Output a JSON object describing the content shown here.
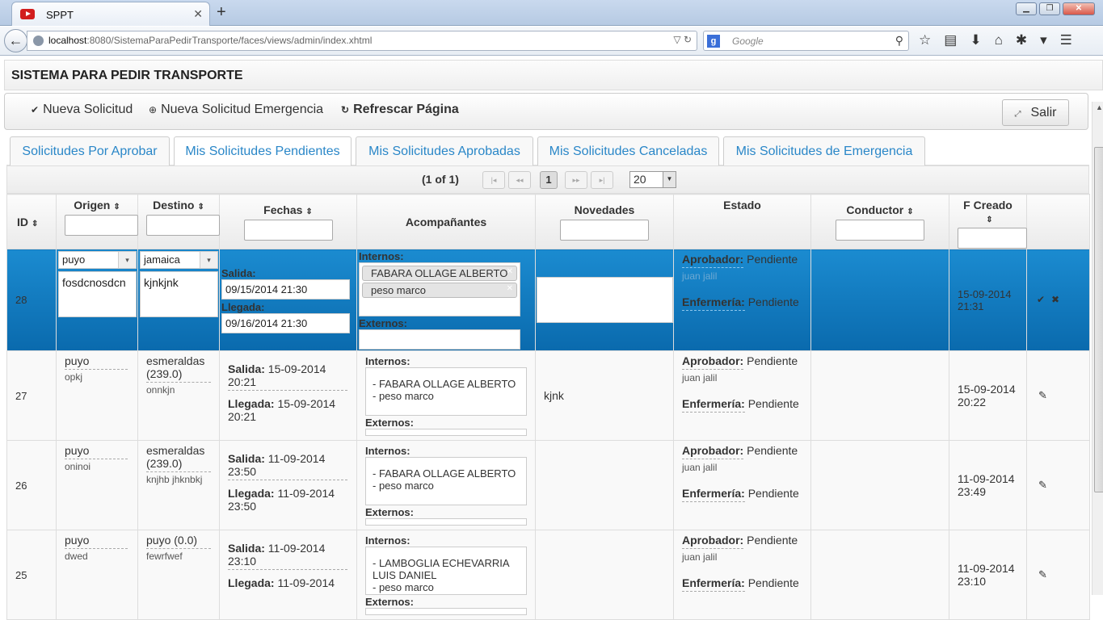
{
  "browser": {
    "tab_title": "SPPT",
    "url_host": "localhost",
    "url_rest": ":8080/SistemaParaPedirTransporte/faces/views/admin/index.xhtml",
    "search_placeholder": "Google"
  },
  "app": {
    "title": "SISTEMA PARA PEDIR TRANSPORTE",
    "menu": {
      "nueva": "Nueva Solicitud",
      "emergencia": "Nueva Solicitud Emergencia",
      "refrescar": "Refrescar Página",
      "salir": "Salir"
    },
    "tabs": [
      "Solicitudes Por Aprobar",
      "Mis Solicitudes Pendientes",
      "Mis Solicitudes Aprobadas",
      "Mis Solicitudes Canceladas",
      "Mis Solicitudes de Emergencia"
    ],
    "pager": {
      "current": "(1 of 1)",
      "page": "1",
      "rows": "20"
    },
    "columns": {
      "id": "ID",
      "origen": "Origen",
      "destino": "Destino",
      "fechas": "Fechas",
      "acomp": "Acompañantes",
      "novedades": "Novedades",
      "estado": "Estado",
      "conductor": "Conductor",
      "fcreado": "F Creado"
    },
    "labels": {
      "salida": "Salida:",
      "llegada": "Llegada:",
      "internos": "Internos:",
      "externos": "Externos:",
      "aprobador": "Aprobador:",
      "enfermeria": "Enfermería:",
      "pendiente": "Pendiente"
    },
    "editing": {
      "id": "28",
      "origen": "puyo",
      "origen_det": "fosdcnosdcn",
      "destino": "jamaica",
      "destino_det": "kjnkjnk",
      "salida": "09/15/2014 21:30",
      "llegada": "09/16/2014 21:30",
      "internos": [
        "FABARA OLLAGE ALBERTO",
        "peso marco"
      ],
      "aprobador_nombre": "juan jalil",
      "creado": "15-09-2014 21:31"
    },
    "rows": [
      {
        "id": "27",
        "origen": "puyo",
        "origen_det": "opkj",
        "destino": "esmeraldas (239.0)",
        "destino_det": "onnkjn",
        "salida": "15-09-2014 20:21",
        "llegada": "15-09-2014 20:21",
        "internos": [
          "- FABARA OLLAGE ALBERTO",
          "- peso marco"
        ],
        "novedades": "kjnk",
        "aprobador_nombre": "juan jalil",
        "creado": "15-09-2014 20:22"
      },
      {
        "id": "26",
        "origen": "puyo",
        "origen_det": "oninoi",
        "destino": "esmeraldas (239.0)",
        "destino_det": "knjhb jhknbkj",
        "salida": "11-09-2014 23:50",
        "llegada": "11-09-2014 23:50",
        "internos": [
          "- FABARA OLLAGE ALBERTO",
          "- peso marco"
        ],
        "novedades": "",
        "aprobador_nombre": "juan jalil",
        "creado": "11-09-2014 23:49"
      },
      {
        "id": "25",
        "origen": "puyo",
        "origen_det": "dwed",
        "destino": "puyo (0.0)",
        "destino_det": "fewrfwef",
        "salida": "11-09-2014 23:10",
        "llegada": "11-09-2014",
        "internos": [
          "- LAMBOGLIA ECHEVARRIA LUIS DANIEL",
          "- peso marco"
        ],
        "novedades": "",
        "aprobador_nombre": "juan jalil",
        "creado": "11-09-2014 23:10"
      }
    ]
  }
}
